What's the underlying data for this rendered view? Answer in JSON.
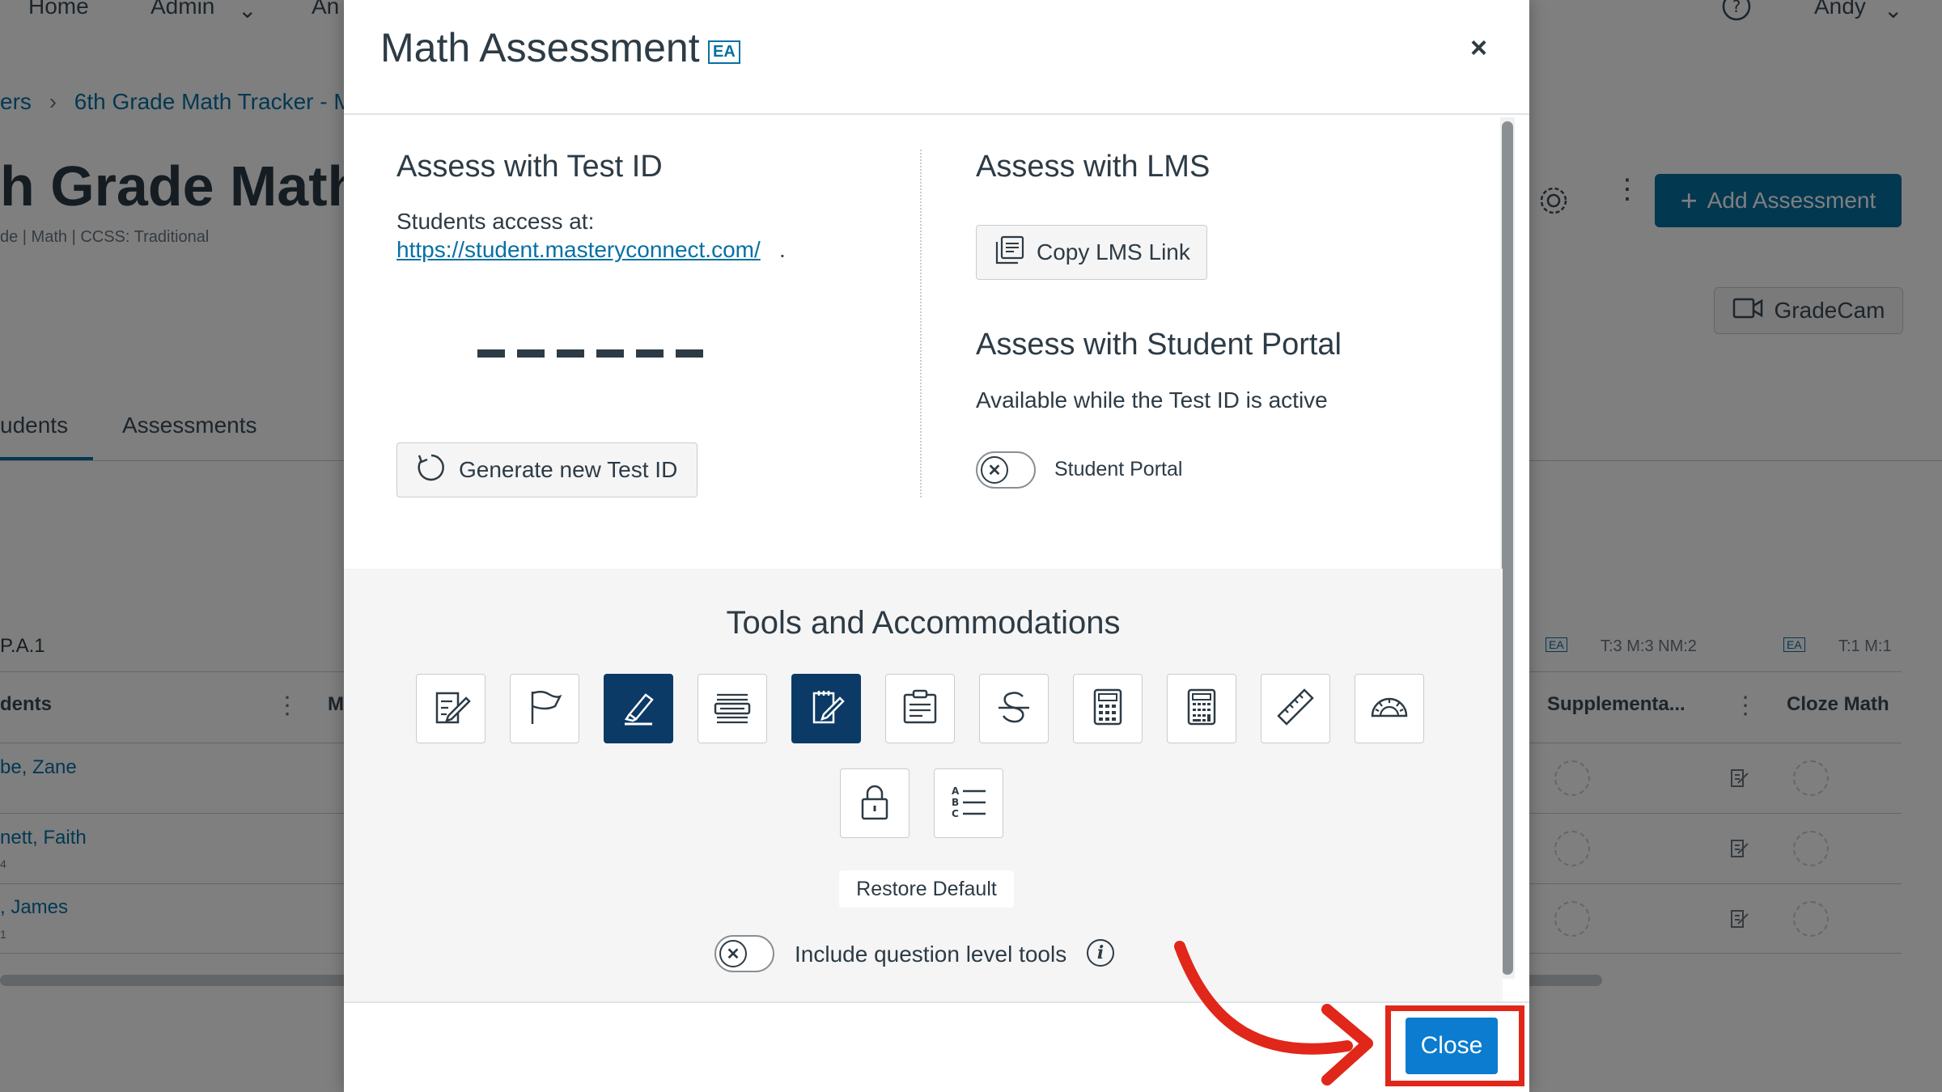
{
  "background": {
    "nav": {
      "home": "Home",
      "admin": "Admin",
      "analytics": "An",
      "user": "Andy"
    },
    "breadcrumb": {
      "parent": "ers",
      "current": "6th Grade Math Tracker - M"
    },
    "page_title": "h Grade Math",
    "page_subtitle": "de  |  Math  |  CCSS: Traditional",
    "add_assessment_label": "Add Assessment",
    "gradecam_label": "GradeCam",
    "tabs": [
      {
        "label": "udents"
      },
      {
        "label": "Assessments"
      }
    ],
    "standard_code": "P.A.1",
    "table_header_students": "dents",
    "table_header_m": "M",
    "col_supplemental": "Supplementa...",
    "col_cloze": "Cloze Math",
    "col_meta_1": "T:3 M:3 NM:2",
    "col_meta_2": "T:1 M:1",
    "col_badge": "EA",
    "students": [
      {
        "name": "be, Zane",
        "sub": ""
      },
      {
        "name": "nett, Faith",
        "sub": "4"
      },
      {
        "name": ", James",
        "sub": "1"
      }
    ]
  },
  "modal": {
    "title": "Math Assessment",
    "title_badge": "EA",
    "close_icon": "×",
    "test_id": {
      "heading": "Assess with Test ID",
      "access_text": "Students access at:",
      "link": "https://student.masteryconnect.com/",
      "link_suffix": ".",
      "generate_label": "Generate new Test ID"
    },
    "lms": {
      "heading": "Assess with LMS",
      "copy_label": "Copy LMS Link"
    },
    "portal": {
      "heading": "Assess with Student Portal",
      "description": "Available while the Test ID is active",
      "toggle_label": "Student Portal",
      "toggle_on": false
    },
    "tools": {
      "heading": "Tools and Accommodations",
      "items": [
        {
          "icon": "annotate-icon",
          "active": false
        },
        {
          "icon": "flag-icon",
          "active": false
        },
        {
          "icon": "highlighter-icon",
          "active": true
        },
        {
          "icon": "line-reader-icon",
          "active": false
        },
        {
          "icon": "notepad-icon",
          "active": true
        },
        {
          "icon": "reference-sheet-icon",
          "active": false
        },
        {
          "icon": "strikethrough-icon",
          "active": false
        },
        {
          "icon": "basic-calculator-icon",
          "active": false
        },
        {
          "icon": "scientific-calculator-icon",
          "active": false
        },
        {
          "icon": "ruler-icon",
          "active": false
        },
        {
          "icon": "protractor-icon",
          "active": false
        },
        {
          "icon": "lock-icon",
          "active": false
        },
        {
          "icon": "answer-choices-icon",
          "active": false
        }
      ],
      "restore_label": "Restore Default",
      "question_level_label": "Include question level tools",
      "question_level_on": false
    },
    "close_label": "Close"
  },
  "colors": {
    "accent": "#0770a3",
    "active_tool": "#0b3a66",
    "close_button": "#0b7ccf",
    "annotation": "#e0271a"
  }
}
